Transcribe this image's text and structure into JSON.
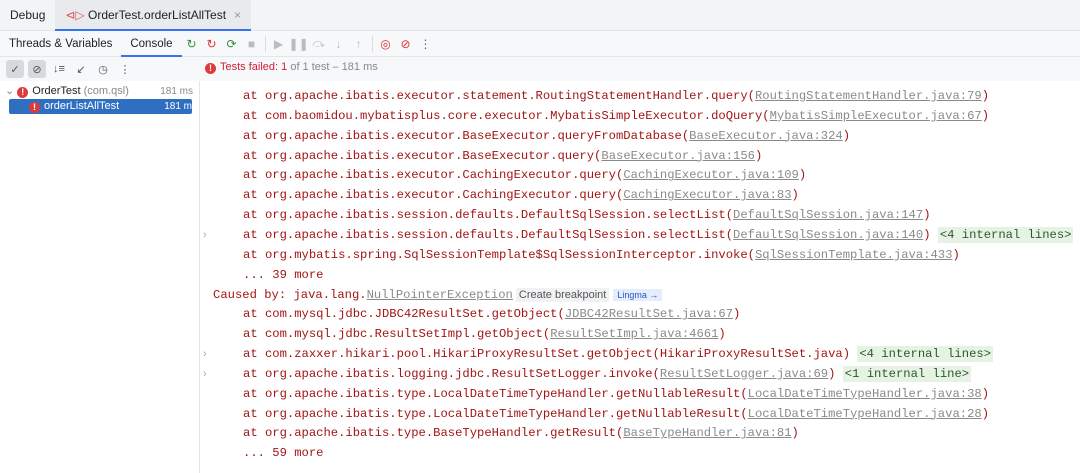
{
  "tabs": [
    {
      "label": "Debug"
    },
    {
      "label": "OrderTest.orderListAllTest",
      "close": "×"
    }
  ],
  "subtabs": [
    "Threads & Variables",
    "Console"
  ],
  "status": {
    "prefix": "Tests failed: ",
    "failed": "1",
    "rest": " of 1 test – 181 ms"
  },
  "tree": [
    {
      "label": "OrderTest",
      "pkg": " (com.qsl)",
      "time": "181 ms"
    },
    {
      "label": "orderListAllTest",
      "time": "181 m"
    }
  ],
  "console": {
    "lines": [
      {
        "pre": "at org.apache.ibatis.executor.statement.RoutingStatementHandler.query(",
        "link": "RoutingStatementHandler.java:79",
        "post": ")"
      },
      {
        "pre": "at com.baomidou.mybatisplus.core.executor.MybatisSimpleExecutor.doQuery(",
        "link": "MybatisSimpleExecutor.java:67",
        "post": ")"
      },
      {
        "pre": "at org.apache.ibatis.executor.BaseExecutor.queryFromDatabase(",
        "link": "BaseExecutor.java:324",
        "post": ")"
      },
      {
        "pre": "at org.apache.ibatis.executor.BaseExecutor.query(",
        "link": "BaseExecutor.java:156",
        "post": ")"
      },
      {
        "pre": "at org.apache.ibatis.executor.CachingExecutor.query(",
        "link": "CachingExecutor.java:109",
        "post": ")"
      },
      {
        "pre": "at org.apache.ibatis.executor.CachingExecutor.query(",
        "link": "CachingExecutor.java:83",
        "post": ")"
      },
      {
        "pre": "at org.apache.ibatis.session.defaults.DefaultSqlSession.selectList(",
        "link": "DefaultSqlSession.java:147",
        "post": ")"
      },
      {
        "pre": "at org.apache.ibatis.session.defaults.DefaultSqlSession.selectList(",
        "link": "DefaultSqlSession.java:140",
        "post": ") ",
        "badge": "<4 internal lines>",
        "fold": true
      },
      {
        "pre": "at org.mybatis.spring.SqlSessionTemplate$SqlSessionInterceptor.invoke(",
        "link": "SqlSessionTemplate.java:433",
        "post": ")"
      },
      {
        "pre": "... 39 more"
      },
      {
        "pre": "Caused by: java.lang.",
        "link": "NullPointerException",
        "cause": true,
        "create": "Create breakpoint",
        "lingma": "Lingma →"
      },
      {
        "pre": "at com.mysql.jdbc.JDBC42ResultSet.getObject(",
        "link": "JDBC42ResultSet.java:67",
        "post": ")"
      },
      {
        "pre": "at com.mysql.jdbc.ResultSetImpl.getObject(",
        "link": "ResultSetImpl.java:4661",
        "post": ")"
      },
      {
        "pre": "at com.zaxxer.hikari.pool.HikariProxyResultSet.getObject(HikariProxyResultSet.java) ",
        "badge": "<4 internal lines>",
        "fold": true
      },
      {
        "pre": "at org.apache.ibatis.logging.jdbc.ResultSetLogger.invoke(",
        "link": "ResultSetLogger.java:69",
        "post": ") ",
        "badge": "<1 internal line>",
        "fold": true
      },
      {
        "pre": "at org.apache.ibatis.type.LocalDateTimeTypeHandler.getNullableResult(",
        "link": "LocalDateTimeTypeHandler.java:38",
        "post": ")"
      },
      {
        "pre": "at org.apache.ibatis.type.LocalDateTimeTypeHandler.getNullableResult(",
        "link": "LocalDateTimeTypeHandler.java:28",
        "post": ")"
      },
      {
        "pre": "at org.apache.ibatis.type.BaseTypeHandler.getResult(",
        "link": "BaseTypeHandler.java:81",
        "post": ")"
      },
      {
        "pre": "... 59 more"
      }
    ]
  }
}
